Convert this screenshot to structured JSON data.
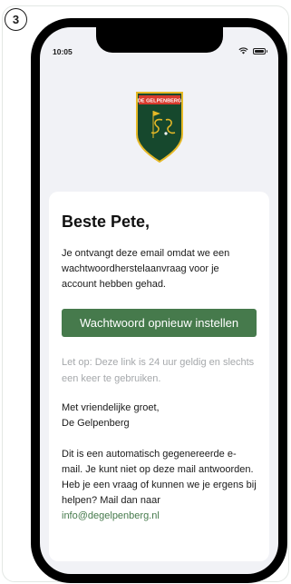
{
  "step": {
    "number": "3"
  },
  "status_bar": {
    "time": "10:05"
  },
  "logo": {
    "text": "DE GELPENBERG",
    "colors": {
      "shield": "#16482d",
      "border": "#e6b927",
      "banner": "#d83a2d"
    }
  },
  "email": {
    "greeting": "Beste Pete,",
    "intro": "Je ontvangt deze email omdat we een wachtwoordherstelaanvraag voor je account hebben gehad.",
    "button_label": "Wachtwoord opnieuw instellen",
    "note": "Let op: Deze link is 24 uur geldig en slechts een keer te gebruiken.",
    "regards_line1": "Met vriendelijke groet,",
    "regards_line2": "De Gelpenberg",
    "auto_note": "Dit is een automatisch gegenereerde e-mail. Je kunt niet op deze mail antwoorden. Heb je een vraag of kunnen we je ergens bij helpen? Mail dan naar",
    "contact_email": "info@degelpenberg.nl"
  },
  "colors": {
    "accent": "#467a4c",
    "muted_text": "#a5a8ab",
    "screen_bg": "#f1f2f6"
  }
}
